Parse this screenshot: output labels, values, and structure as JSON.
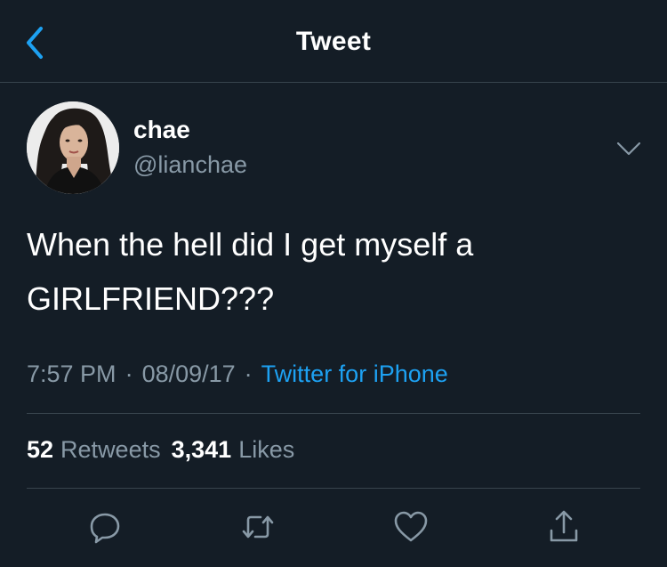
{
  "nav": {
    "title": "Tweet",
    "back_icon": "chevron-left-icon"
  },
  "tweet": {
    "display_name": "chae",
    "handle": "@lianchae",
    "text": "When the hell did I get myself a GIRLFRIEND???",
    "time": "7:57 PM",
    "separator": "·",
    "date": "08/09/17",
    "source": "Twitter for iPhone",
    "retweet_count": "52",
    "retweet_label": "Retweets",
    "like_count": "3,341",
    "like_label": "Likes"
  },
  "actions": [
    {
      "name": "reply",
      "icon": "reply-icon"
    },
    {
      "name": "retweet",
      "icon": "retweet-icon"
    },
    {
      "name": "like",
      "icon": "heart-icon"
    },
    {
      "name": "share",
      "icon": "share-icon"
    }
  ],
  "colors": {
    "background": "#141d26",
    "text": "#ffffff",
    "muted": "#8899a6",
    "accent": "#1da1f2",
    "divider": "#38444d"
  }
}
